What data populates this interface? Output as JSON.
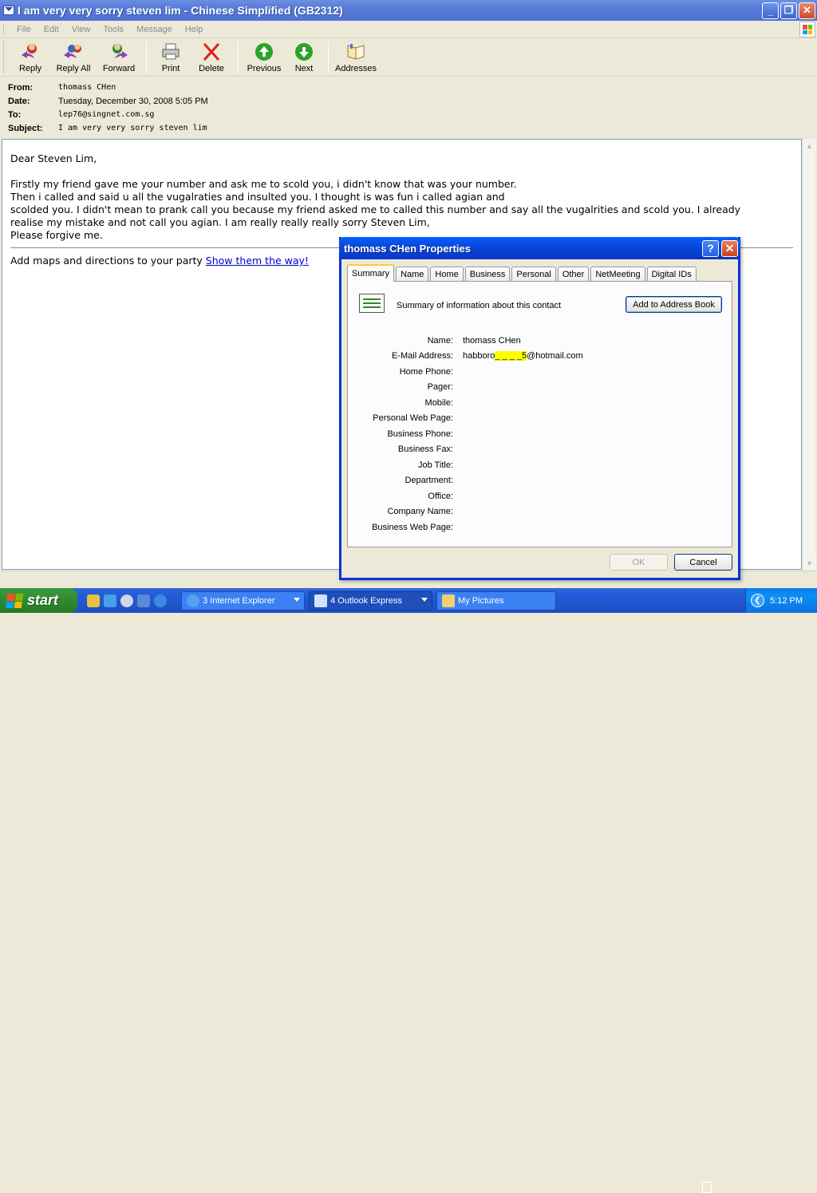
{
  "window": {
    "title": "I am very very sorry steven lim - Chinese Simplified (GB2312)",
    "controls": {
      "minimize": "_",
      "maximize": "❐",
      "close": "✕"
    }
  },
  "menu": [
    "File",
    "Edit",
    "View",
    "Tools",
    "Message",
    "Help"
  ],
  "toolbar": {
    "reply": "Reply",
    "reply_all": "Reply All",
    "forward": "Forward",
    "print": "Print",
    "delete": "Delete",
    "previous": "Previous",
    "next": "Next",
    "addresses": "Addresses"
  },
  "header": {
    "from_label": "From:",
    "from": "thomass CHen",
    "date_label": "Date:",
    "date": "Tuesday, December 30, 2008 5:05 PM",
    "to_label": "To:",
    "to": "lep76@singnet.com.sg",
    "subject_label": "Subject:",
    "subject": "I am very very sorry steven lim"
  },
  "message": {
    "greeting": "Dear Steven Lim,",
    "line1": "Firstly my friend gave me your number and ask me to scold you, i didn't know that was your number.",
    "line2": "Then i called and said u all the vugalraties and insulted you. I thought is was fun i called agian and",
    "line3": "scolded you. I didn't mean to prank call you because my friend asked me to called this number and say all the vugalrities and scold you. I already",
    "line4": "realise my mistake and not call you agian. I am really really really sorry Steven Lim,",
    "line5": "Please forgive me.",
    "footer_text": "Add maps and directions to your party ",
    "footer_link": "Show them the way!"
  },
  "dialog": {
    "title": "thomass CHen Properties",
    "help": "?",
    "close": "✕",
    "tabs": [
      "Summary",
      "Name",
      "Home",
      "Business",
      "Personal",
      "Other",
      "NetMeeting",
      "Digital IDs"
    ],
    "active_tab": "Summary",
    "summary_text": "Summary of information about this contact",
    "add_button": "Add to Address Book",
    "fields": [
      {
        "label": "Name:",
        "value": "thomass CHen"
      },
      {
        "label": "E-Mail Address:",
        "value_prefix": "habboro",
        "value_redacted": "_ _ _ _5",
        "value_suffix": "@hotmail.com"
      },
      {
        "label": "Home Phone:",
        "value": ""
      },
      {
        "label": "Pager:",
        "value": ""
      },
      {
        "label": "Mobile:",
        "value": ""
      },
      {
        "label": "Personal Web Page:",
        "value": ""
      },
      {
        "label": "Business Phone:",
        "value": ""
      },
      {
        "label": "Business Fax:",
        "value": ""
      },
      {
        "label": "Job Title:",
        "value": ""
      },
      {
        "label": "Department:",
        "value": ""
      },
      {
        "label": "Office:",
        "value": ""
      },
      {
        "label": "Company Name:",
        "value": ""
      },
      {
        "label": "Business Web Page:",
        "value": ""
      }
    ],
    "ok": "OK",
    "cancel": "Cancel"
  },
  "taskbar": {
    "start": "start",
    "tasks": [
      {
        "label": "3 Internet Explorer"
      },
      {
        "label": "4 Outlook Express"
      },
      {
        "label": "My Pictures"
      }
    ],
    "clock": "5:12 PM",
    "tray_chevron": "❮"
  },
  "colors": {
    "title_blue": "#0a5ffb",
    "link": "#0000cc",
    "highlight": "#ffff00",
    "start_green": "#2f8a2f"
  }
}
